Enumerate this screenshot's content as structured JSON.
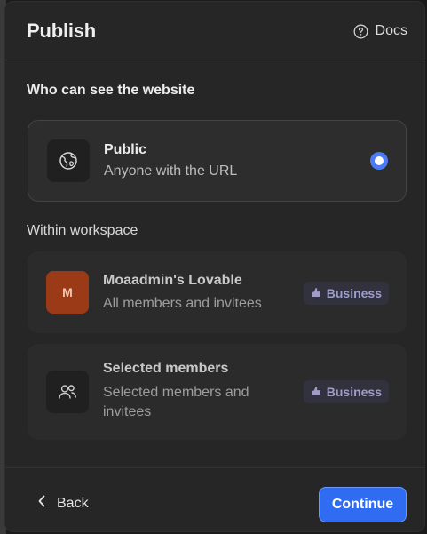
{
  "dialog": {
    "title": "Publish",
    "docs_label": "Docs"
  },
  "visibility": {
    "heading": "Who can see the website",
    "public": {
      "title": "Public",
      "description": "Anyone with the URL",
      "selected": true
    },
    "workspace_heading": "Within workspace",
    "workspace": {
      "avatar_initial": "M",
      "title": "Moaadmin's Lovable",
      "description": "All members and invitees",
      "badge": "Business"
    },
    "selected_members": {
      "title": "Selected members",
      "description_line1": "Selected members and",
      "description_line2": "invitees",
      "badge": "Business"
    }
  },
  "footer": {
    "back_label": "Back",
    "continue_label": "Continue"
  },
  "icons": {
    "docs": "question-circle-icon",
    "public": "globe-icon",
    "selected_members": "users-icon",
    "badge": "hand-icon",
    "back": "chevron-left-icon"
  },
  "colors": {
    "accent": "#2f6cf2",
    "radio": "#4b7bf5",
    "avatar": "#9a3a16",
    "badge_text": "#9d9dc8",
    "badge_bg": "#32323f"
  }
}
